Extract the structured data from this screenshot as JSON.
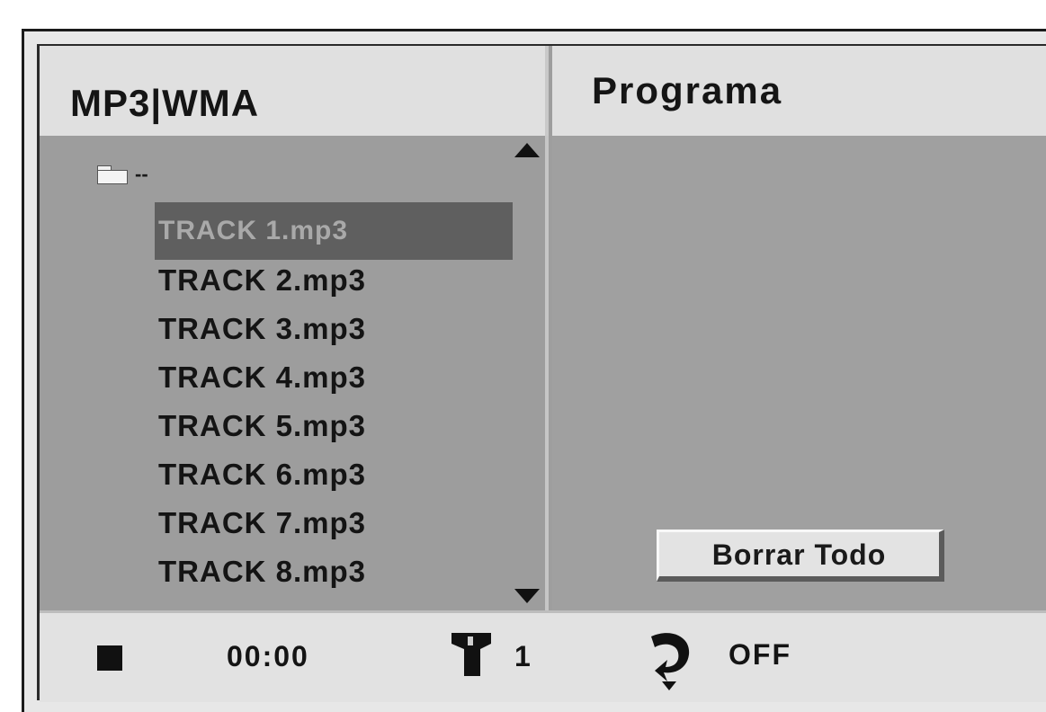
{
  "left_panel": {
    "title": "MP3|WMA",
    "folder_label": "--",
    "tracks": [
      {
        "label": "TRACK 1.mp3",
        "selected": true
      },
      {
        "label": "TRACK 2.mp3",
        "selected": false
      },
      {
        "label": "TRACK 3.mp3",
        "selected": false
      },
      {
        "label": "TRACK 4.mp3",
        "selected": false
      },
      {
        "label": "TRACK 5.mp3",
        "selected": false
      },
      {
        "label": "TRACK 6.mp3",
        "selected": false
      },
      {
        "label": "TRACK 7.mp3",
        "selected": false
      },
      {
        "label": "TRACK 8.mp3",
        "selected": false
      }
    ]
  },
  "right_panel": {
    "title": "Programa",
    "clear_all_label": "Borrar Todo"
  },
  "status": {
    "time": "00:00",
    "track_number": "1",
    "repeat": "OFF"
  },
  "icons": {
    "stop": "stop-icon",
    "folder": "folder-icon",
    "track": "track-icon",
    "repeat": "repeat-icon",
    "scroll_up": "scroll-up-arrow-icon",
    "scroll_down": "scroll-down-arrow-icon"
  },
  "colors": {
    "panel_bg": "#9e9e9e",
    "header_bg": "#e0e0e0",
    "selected_bg": "#5f5f5f",
    "text": "#141414"
  }
}
